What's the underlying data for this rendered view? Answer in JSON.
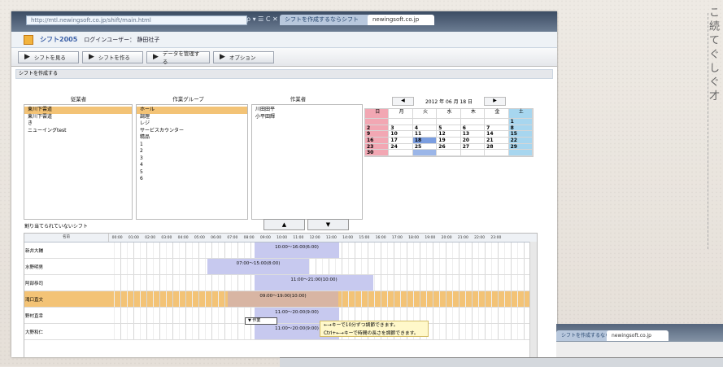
{
  "browser": {
    "address": "http://mtl.newingsoft.co.jp/shift/main.html",
    "nav": "ρ ▾ ☰ C ✕",
    "tabs": [
      "シフトを作成するならシフト",
      "newingsoft.co.jp"
    ]
  },
  "app": {
    "brand": "シフト2005",
    "user": "ログインユーザー： 静田社子"
  },
  "toolbar": {
    "buttons": [
      "シフトを見る",
      "シフトを作る",
      "データを管理する",
      "オプション"
    ]
  },
  "sections": {
    "shift_create": "シフトを作成する",
    "headers": [
      "従業者",
      "作業グループ",
      "作業者"
    ],
    "unassigned": "割り当てられていないシフト"
  },
  "lists": {
    "employees": [
      "東川下雲道",
      "東川下雲道",
      "き",
      "ニューイングtest"
    ],
    "groups": [
      "ホール",
      "調理",
      "レジ",
      "サービスカウンター",
      "精品",
      "1",
      "2",
      "3",
      "4",
      "5",
      "6"
    ],
    "workers": [
      "川田田平",
      "小平田輝"
    ]
  },
  "calendar": {
    "title": "2012 年 06 月 18 日",
    "weekdays": [
      "日",
      "月",
      "火",
      "水",
      "木",
      "金",
      "土"
    ],
    "days": [
      "",
      "",
      "",
      "",
      "",
      "",
      "1",
      "2",
      "3",
      "4",
      "5",
      "6",
      "7",
      "8",
      "9",
      "10",
      "11",
      "12",
      "13",
      "14",
      "15",
      "16",
      "17",
      "18",
      "19",
      "20",
      "21",
      "22",
      "23",
      "24",
      "25",
      "26",
      "27",
      "28",
      "29",
      "30",
      "",
      "",
      "",
      "",
      "",
      ""
    ]
  },
  "timeline": {
    "name_header": "名前",
    "time_labels": [
      "00:00",
      "01:00",
      "02:00",
      "03:00",
      "04:00",
      "05:00",
      "06:00",
      "07:00",
      "08:00",
      "09:00",
      "10:00",
      "11:00",
      "12:00",
      "13:00",
      "14:00",
      "15:00",
      "16:00",
      "17:00",
      "18:00",
      "19:00",
      "20:00",
      "21:00",
      "22:00",
      "23:00"
    ],
    "rows": [
      {
        "name": "新井大輔",
        "shift": "10:00〜16:00(6:00)"
      },
      {
        "name": "水野明男",
        "shift": "07:00〜15:00(8:00)"
      },
      {
        "name": "阿部恭司",
        "shift": "11:00〜21:00(10:00)"
      },
      {
        "name": "滝口直文",
        "shift": "09:00〜19:00(10:00)"
      },
      {
        "name": "野村直幸",
        "shift": "11:00〜20:00(9:00)"
      },
      {
        "name": "大野和仁",
        "shift": "11:00〜20:00(9:00)"
      }
    ],
    "select": "▼ 作業",
    "note_lines": [
      "←→キーで10分ずつ調節できます。",
      "Ctrl+←→キーで時間の長さを調節できます。"
    ]
  },
  "vertical_caption": "こ 続 て ぐ し ぐ 才"
}
